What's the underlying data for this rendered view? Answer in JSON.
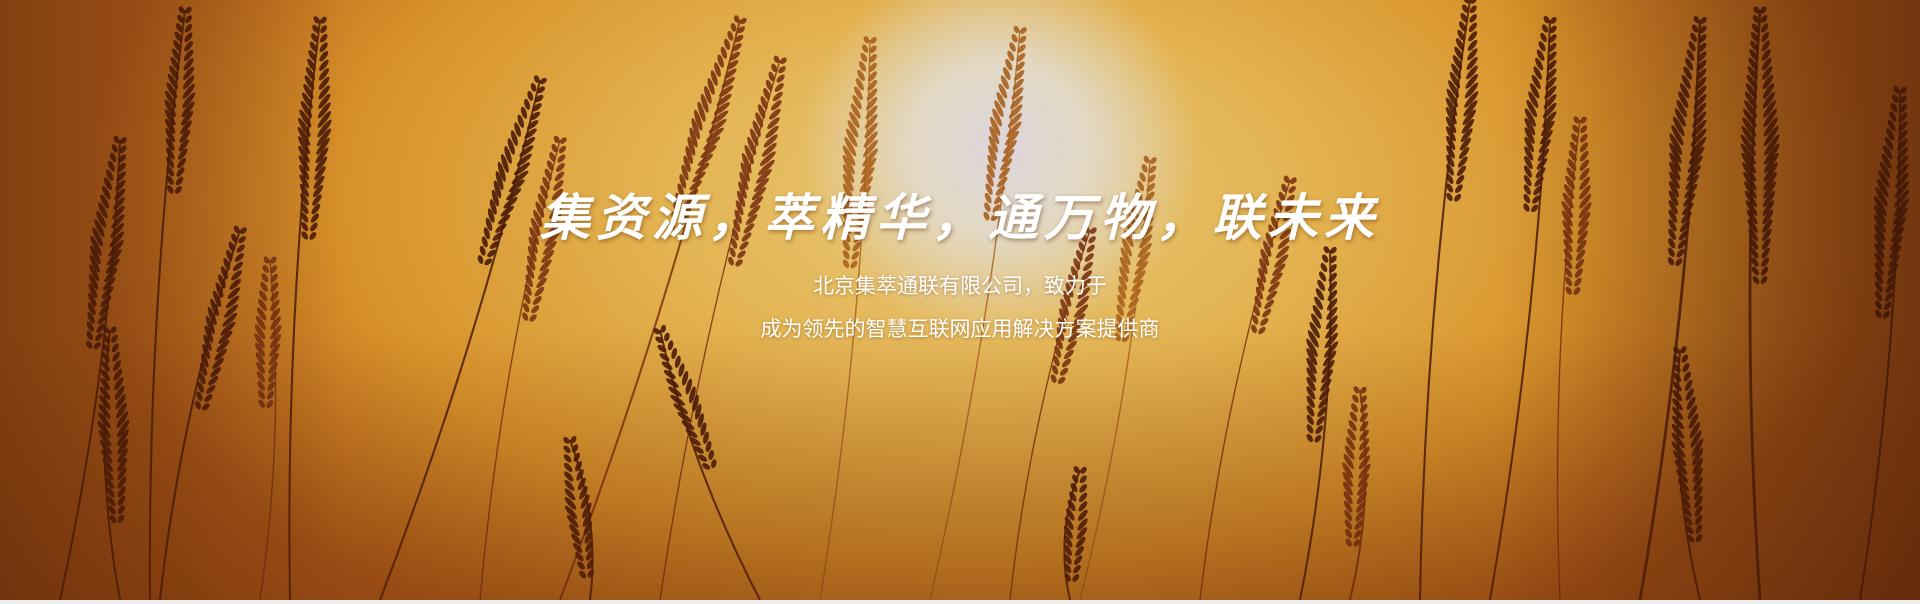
{
  "hero": {
    "slogan": "集资源，萃精华，通万物，联未来",
    "description_line1": "北京集萃通联有限公司，致力于",
    "description_line2": "成为领先的智慧互联网应用解决方案提供商",
    "palette": {
      "sun": "#ddd6dc",
      "sky_light": "#e8c978",
      "sky_mid": "#e3b452",
      "sky_deep": "#b4601a",
      "reed_dark": "#4a1c08",
      "reed_mid": "#7a3412",
      "reed_light": "#a8601e"
    }
  }
}
